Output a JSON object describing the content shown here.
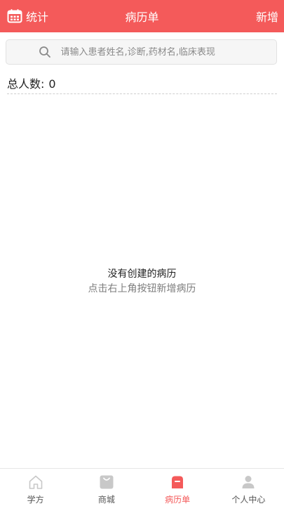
{
  "header": {
    "left_label": "统计",
    "left_icon": "calendar-icon",
    "title": "病历单",
    "right_label": "新增"
  },
  "search": {
    "icon": "search-icon",
    "placeholder": "请输入患者姓名,诊断,药材名,临床表现",
    "value": ""
  },
  "summary": {
    "total_label": "总人数:",
    "total_value": "0"
  },
  "empty_state": {
    "line1": "没有创建的病历",
    "line2": "点击右上角按钮新增病历"
  },
  "tabbar": {
    "items": [
      {
        "label": "学方",
        "icon": "home-icon"
      },
      {
        "label": "商城",
        "icon": "shopping-bag-icon"
      },
      {
        "label": "病历单",
        "icon": "medical-record-icon",
        "active": true
      },
      {
        "label": "个人中心",
        "icon": "person-icon"
      }
    ]
  },
  "colors": {
    "accent": "#f45a5a",
    "inactive_icon": "#c8c8c8"
  }
}
